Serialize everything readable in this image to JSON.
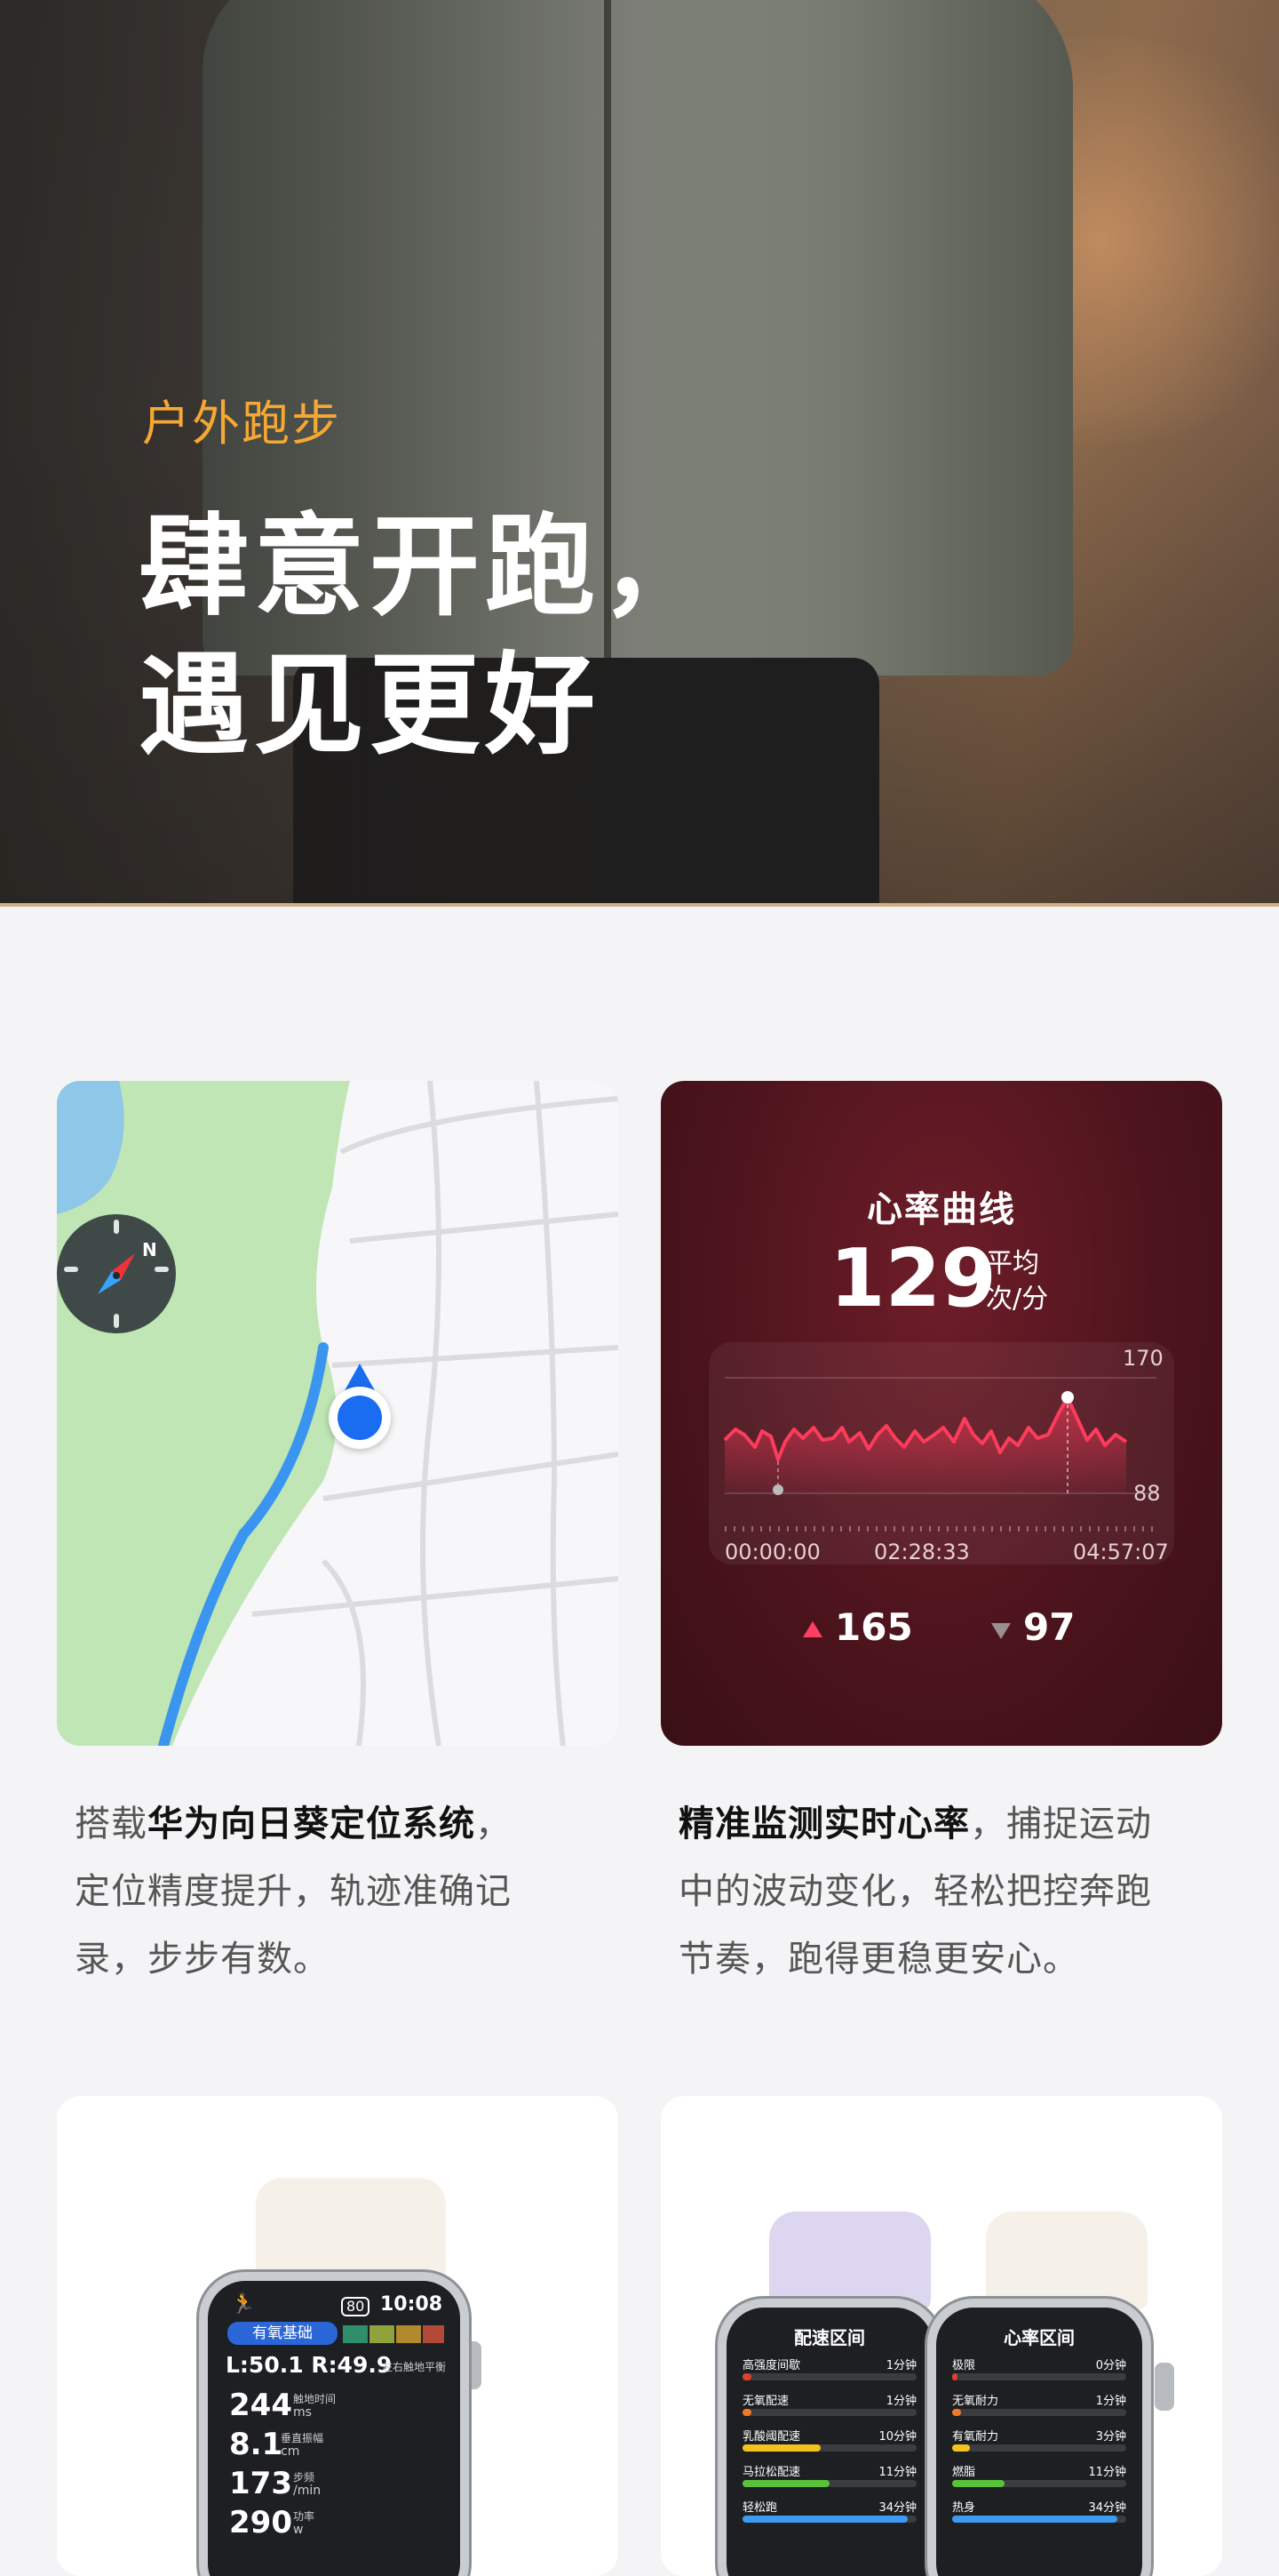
{
  "hero": {
    "tag": "户外跑步",
    "title_line1": "肆意开跑，",
    "title_line2": "遇见更好"
  },
  "heart_rate": {
    "title": "心率曲线",
    "average": "129",
    "avg_label": "平均",
    "unit": "次/分",
    "axis_max": "170",
    "axis_min": "88",
    "time_start": "00:00:00",
    "time_mid": "02:28:33",
    "time_end": "04:57:07",
    "max_value": "165",
    "min_value": "97",
    "colors": {
      "line": "#ff3b5c",
      "max_marker": "#ff4060",
      "min_marker": "#9a8f93"
    }
  },
  "map": {
    "compass_letter": "N",
    "colors": {
      "park": "#bfe6b4",
      "water": "#8ec7e8",
      "route": "#3a95f0",
      "pin": "#1a6cf0"
    }
  },
  "desc_left": {
    "pre": "搭载",
    "bold": "华为向日葵定位系统",
    "line1_end": "，",
    "line2": "定位精度提升，轨迹准确记",
    "line3": "录，步步有数。"
  },
  "desc_right": {
    "bold": "精准监测实时心率",
    "line1_end": "，捕捉运动",
    "line2": "中的波动变化，轻松把控奔跑",
    "line3": "节奏，跑得更稳更安心。"
  },
  "watch1": {
    "battery": "80",
    "time": "10:08",
    "mode": "有氧基础",
    "balance": "L:50.1 R:49.9",
    "balance_label": "左右触地平衡",
    "metrics": [
      {
        "value": "244",
        "label": "触地时间",
        "unit": "ms"
      },
      {
        "value": "8.1",
        "label": "垂直振幅",
        "unit": "cm"
      },
      {
        "value": "173",
        "label": "步频",
        "unit": "/min"
      },
      {
        "value": "290",
        "label": "功率",
        "unit": "w"
      }
    ]
  },
  "watch2": {
    "title": "配速区间",
    "rows": [
      {
        "label": "高强度间歇",
        "time": "1分钟",
        "color": "#e0402f",
        "fill": 0.05
      },
      {
        "label": "无氧配速",
        "time": "1分钟",
        "color": "#f07a2a",
        "fill": 0.05
      },
      {
        "label": "乳酸阈配速",
        "time": "10分钟",
        "color": "#f3c21d",
        "fill": 0.45
      },
      {
        "label": "马拉松配速",
        "time": "11分钟",
        "color": "#58c23a",
        "fill": 0.5
      },
      {
        "label": "轻松跑",
        "time": "34分钟",
        "color": "#3a9bf0",
        "fill": 0.95
      }
    ]
  },
  "watch3": {
    "title": "心率区间",
    "rows": [
      {
        "label": "极限",
        "time": "0分钟",
        "color": "#e0402f",
        "fill": 0.0
      },
      {
        "label": "无氧耐力",
        "time": "1分钟",
        "color": "#f07a2a",
        "fill": 0.05
      },
      {
        "label": "有氧耐力",
        "time": "3分钟",
        "color": "#f3c21d",
        "fill": 0.1
      },
      {
        "label": "燃脂",
        "time": "11分钟",
        "color": "#58c23a",
        "fill": 0.3
      },
      {
        "label": "热身",
        "time": "34分钟",
        "color": "#3a9bf0",
        "fill": 0.95
      }
    ]
  }
}
